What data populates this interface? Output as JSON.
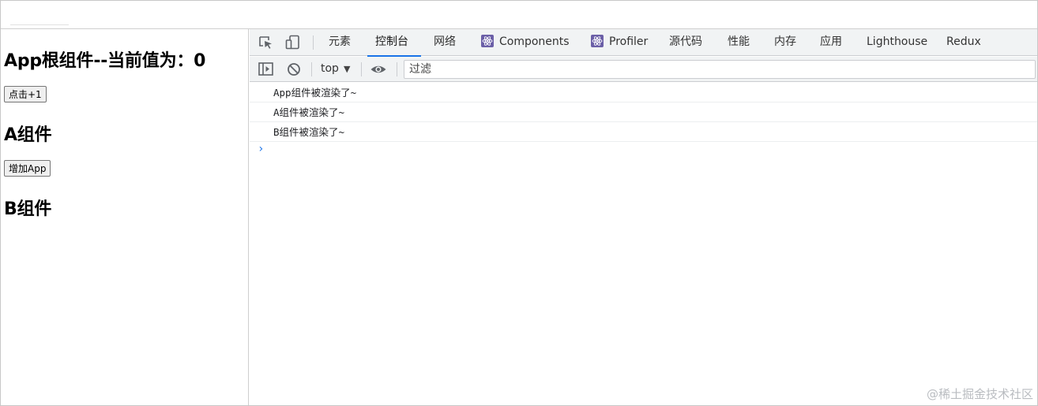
{
  "app": {
    "root_heading": "App根组件--当前值为：0",
    "increment_button": "点击+1",
    "a_heading": "A组件",
    "add_app_button": "增加App",
    "b_heading": "B组件"
  },
  "devtools": {
    "tabs": [
      {
        "label": "元素"
      },
      {
        "label": "控制台"
      },
      {
        "label": "网络"
      },
      {
        "label": "Components"
      },
      {
        "label": "Profiler"
      },
      {
        "label": "源代码"
      },
      {
        "label": "性能"
      },
      {
        "label": "内存"
      },
      {
        "label": "应用"
      },
      {
        "label": "Lighthouse"
      },
      {
        "label": "Redux"
      }
    ],
    "active_tab": "控制台",
    "context": "top",
    "filter_placeholder": "过滤",
    "logs": [
      "App组件被渲染了~",
      "A组件被渲染了~",
      "B组件被渲染了~"
    ],
    "prompt_symbol": "›",
    "accent_color": "#1a73e8"
  },
  "watermark": "@稀土掘金技术社区"
}
